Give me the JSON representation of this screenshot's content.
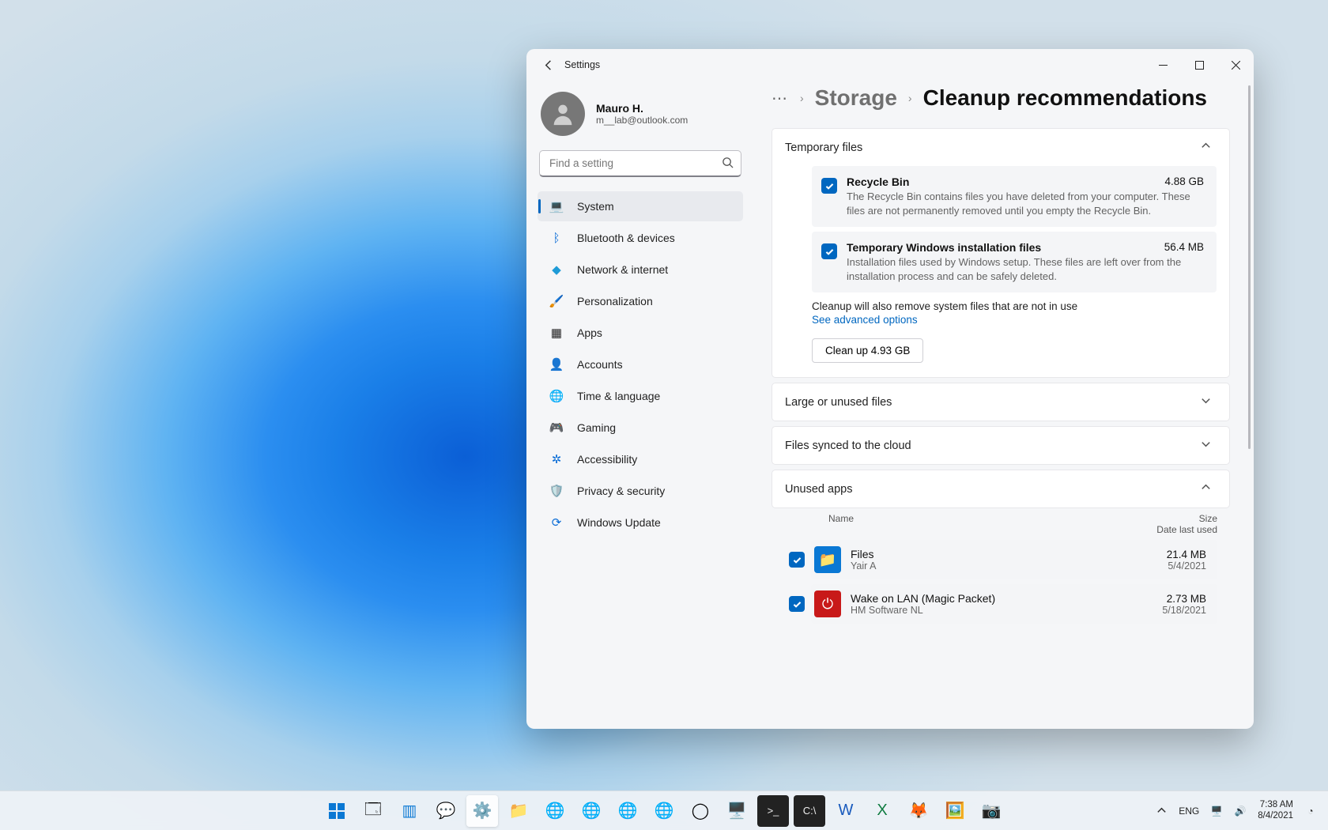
{
  "window": {
    "title": "Settings",
    "profile": {
      "name": "Mauro H.",
      "email": "m__lab@outlook.com"
    },
    "search_placeholder": "Find a setting"
  },
  "nav": {
    "items": [
      {
        "label": "System"
      },
      {
        "label": "Bluetooth & devices"
      },
      {
        "label": "Network & internet"
      },
      {
        "label": "Personalization"
      },
      {
        "label": "Apps"
      },
      {
        "label": "Accounts"
      },
      {
        "label": "Time & language"
      },
      {
        "label": "Gaming"
      },
      {
        "label": "Accessibility"
      },
      {
        "label": "Privacy & security"
      },
      {
        "label": "Windows Update"
      }
    ]
  },
  "breadcrumb": {
    "level1": "Storage",
    "level2": "Cleanup recommendations"
  },
  "temp": {
    "header": "Temporary files",
    "rows": [
      {
        "title": "Recycle Bin",
        "size": "4.88 GB",
        "desc": "The Recycle Bin contains files you have deleted from your computer. These files are not permanently removed until you empty the Recycle Bin."
      },
      {
        "title": "Temporary Windows installation files",
        "size": "56.4 MB",
        "desc": "Installation files used by Windows setup.  These files are left over from the installation process and can be safely deleted."
      }
    ],
    "info": "Cleanup will also remove system files that are not in use",
    "link": "See advanced options",
    "button": "Clean up 4.93 GB"
  },
  "large": {
    "header": "Large or unused files"
  },
  "cloud": {
    "header": "Files synced to the cloud"
  },
  "unused": {
    "header": "Unused apps",
    "col_name": "Name",
    "col_size": "Size",
    "col_date": "Date last used",
    "apps": [
      {
        "name": "Files",
        "publisher": "Yair A",
        "size": "21.4 MB",
        "date": "5/4/2021",
        "icon_bg": "#0a78d4",
        "icon_glyph": "📁"
      },
      {
        "name": "Wake on LAN (Magic Packet)",
        "publisher": "HM Software NL",
        "size": "2.73 MB",
        "date": "5/18/2021",
        "icon_bg": "#c81919",
        "icon_glyph": "⏻"
      }
    ]
  },
  "taskbar": {
    "lang": "ENG",
    "time": "7:38 AM",
    "date": "8/4/2021"
  }
}
